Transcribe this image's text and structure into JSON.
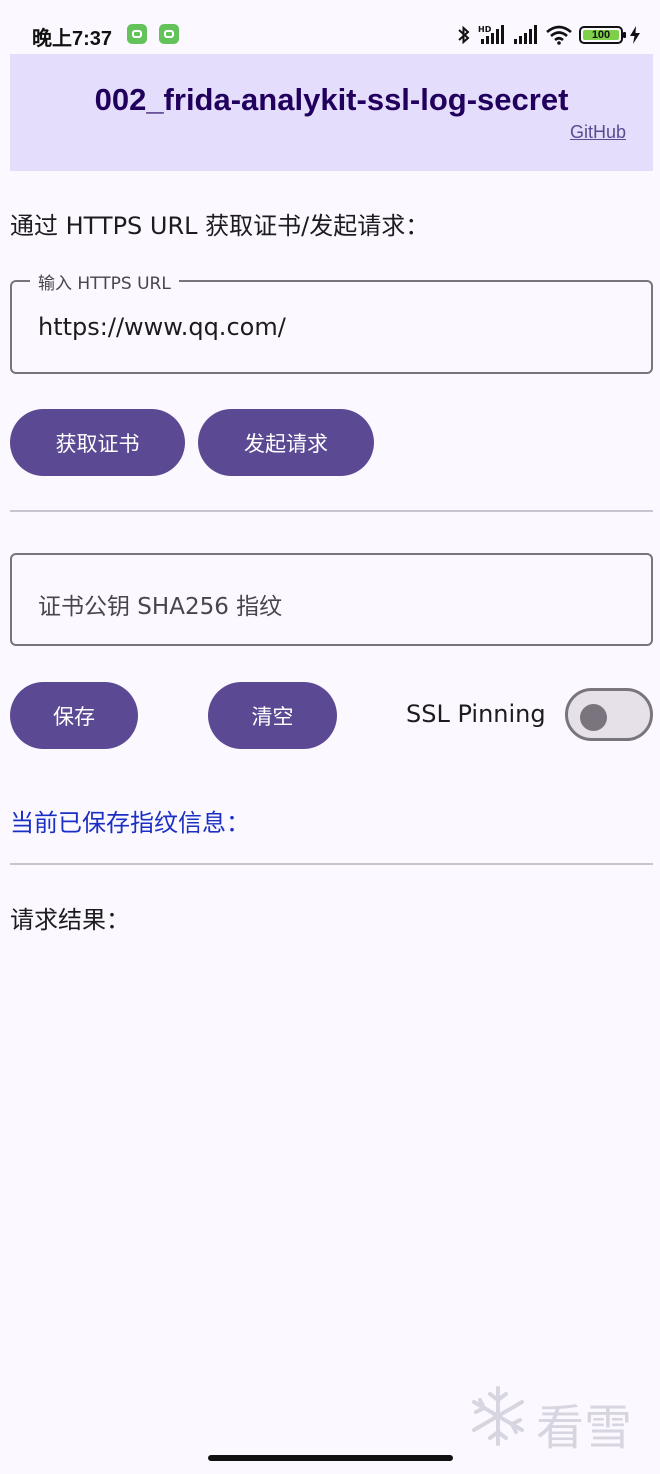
{
  "status_bar": {
    "time": "晚上7:37",
    "battery_level": "100",
    "icons": [
      "app-notification-icon",
      "app-notification-icon",
      "bluetooth-icon",
      "hd-signal-icon",
      "signal-icon",
      "wifi-icon",
      "battery-icon",
      "charging-icon"
    ]
  },
  "header": {
    "title": "002_frida-analykit-ssl-log-secret",
    "github_link": "GitHub"
  },
  "url_section": {
    "label": "通过 HTTPS URL 获取证书/发起请求：",
    "input_label": "输入 HTTPS URL",
    "input_value": "https://www.qq.com/"
  },
  "actions": {
    "get_cert": "获取证书",
    "send_request": "发起请求"
  },
  "fingerprint": {
    "placeholder": "证书公钥 SHA256 指纹",
    "save": "保存",
    "clear": "清空",
    "ssl_pinning_label": "SSL Pinning",
    "ssl_pinning_enabled": false
  },
  "saved_info_label": "当前已保存指纹信息：",
  "result_label": "请求结果：",
  "watermark_text": "看雪",
  "colors": {
    "background": "#fcf8ff",
    "header_bg": "#e5ddfc",
    "title": "#21005d",
    "button": "#5b4a93",
    "saved_info": "#1a2fc4",
    "outline": "#79747e",
    "divider": "#cac4d0"
  }
}
